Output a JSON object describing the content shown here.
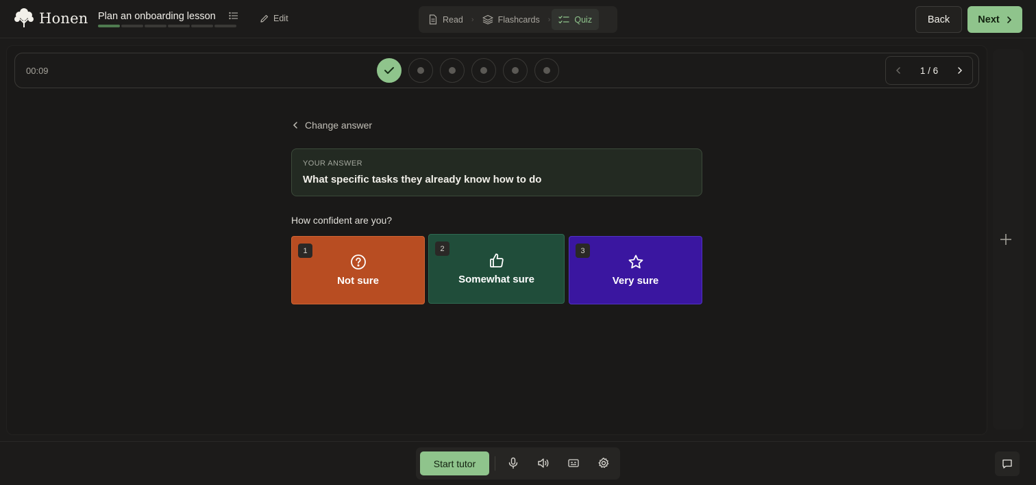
{
  "brand": {
    "name": "Honen"
  },
  "lesson": {
    "title": "Plan an onboarding lesson",
    "progress_segments": 6,
    "progress_completed": 1
  },
  "header": {
    "edit_label": "Edit",
    "modes": [
      {
        "label": "Read",
        "icon": "document-icon",
        "active": false
      },
      {
        "label": "Flashcards",
        "icon": "layers-icon",
        "active": false
      },
      {
        "label": "Quiz",
        "icon": "checklist-icon",
        "active": true
      }
    ],
    "back_label": "Back",
    "next_label": "Next"
  },
  "quiz": {
    "timer": "00:09",
    "steps": [
      "done",
      "pending",
      "pending",
      "pending",
      "pending",
      "pending"
    ],
    "pager": "1 / 6",
    "change_answer_label": "Change answer",
    "answer_label": "YOUR ANSWER",
    "answer_text": "What specific tasks they already know how to do",
    "confidence_question": "How confident are you?",
    "options": [
      {
        "key": "1",
        "label": "Not sure",
        "icon": "question-circle-icon",
        "color": "#b84d22"
      },
      {
        "key": "2",
        "label": "Somewhat sure",
        "icon": "thumbs-up-icon",
        "color": "#204d3a"
      },
      {
        "key": "3",
        "label": "Very sure",
        "icon": "star-icon",
        "color": "#3a16a0"
      }
    ]
  },
  "tutor": {
    "start_label": "Start tutor"
  },
  "colors": {
    "accent": "#8fc48c",
    "background": "#1c1b1a"
  }
}
